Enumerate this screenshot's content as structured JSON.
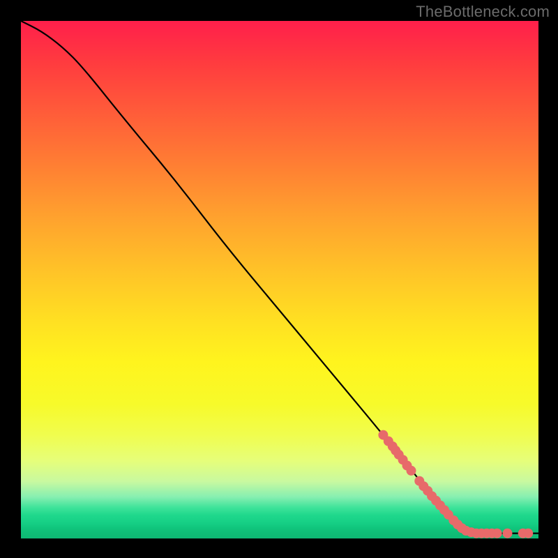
{
  "watermark": "TheBottleneck.com",
  "chart_data": {
    "type": "line",
    "title": "",
    "xlabel": "",
    "ylabel": "",
    "xlim": [
      0,
      100
    ],
    "ylim": [
      0,
      100
    ],
    "grid": false,
    "legend": false,
    "curve": [
      {
        "x": 0,
        "y": 100
      },
      {
        "x": 4,
        "y": 98
      },
      {
        "x": 8,
        "y": 95
      },
      {
        "x": 12,
        "y": 91
      },
      {
        "x": 20,
        "y": 81
      },
      {
        "x": 30,
        "y": 69
      },
      {
        "x": 40,
        "y": 56
      },
      {
        "x": 50,
        "y": 44
      },
      {
        "x": 60,
        "y": 32
      },
      {
        "x": 70,
        "y": 20
      },
      {
        "x": 78,
        "y": 10
      },
      {
        "x": 84,
        "y": 3
      },
      {
        "x": 86,
        "y": 1.5
      },
      {
        "x": 88,
        "y": 1
      },
      {
        "x": 100,
        "y": 1
      }
    ],
    "points": [
      {
        "x": 70.0,
        "y": 20.0
      },
      {
        "x": 71.0,
        "y": 18.8
      },
      {
        "x": 71.8,
        "y": 17.8
      },
      {
        "x": 72.4,
        "y": 17.0
      },
      {
        "x": 73.0,
        "y": 16.2
      },
      {
        "x": 73.8,
        "y": 15.2
      },
      {
        "x": 74.6,
        "y": 14.1
      },
      {
        "x": 75.4,
        "y": 13.1
      },
      {
        "x": 77.0,
        "y": 11.1
      },
      {
        "x": 77.8,
        "y": 10.1
      },
      {
        "x": 78.6,
        "y": 9.2
      },
      {
        "x": 79.4,
        "y": 8.2
      },
      {
        "x": 80.2,
        "y": 7.3
      },
      {
        "x": 81.0,
        "y": 6.4
      },
      {
        "x": 81.8,
        "y": 5.5
      },
      {
        "x": 82.6,
        "y": 4.6
      },
      {
        "x": 83.6,
        "y": 3.5
      },
      {
        "x": 84.4,
        "y": 2.7
      },
      {
        "x": 85.2,
        "y": 2.0
      },
      {
        "x": 86.0,
        "y": 1.5
      },
      {
        "x": 87.0,
        "y": 1.2
      },
      {
        "x": 88.0,
        "y": 1.0
      },
      {
        "x": 89.0,
        "y": 1.0
      },
      {
        "x": 90.0,
        "y": 1.0
      },
      {
        "x": 91.0,
        "y": 1.0
      },
      {
        "x": 92.0,
        "y": 1.0
      },
      {
        "x": 94.0,
        "y": 1.0
      },
      {
        "x": 97.0,
        "y": 1.0
      },
      {
        "x": 98.0,
        "y": 1.0
      }
    ],
    "colors": {
      "background_top": "#ff1f4b",
      "background_bottom": "#0eb873",
      "curve": "#000000",
      "points": "#e76a6a"
    }
  }
}
